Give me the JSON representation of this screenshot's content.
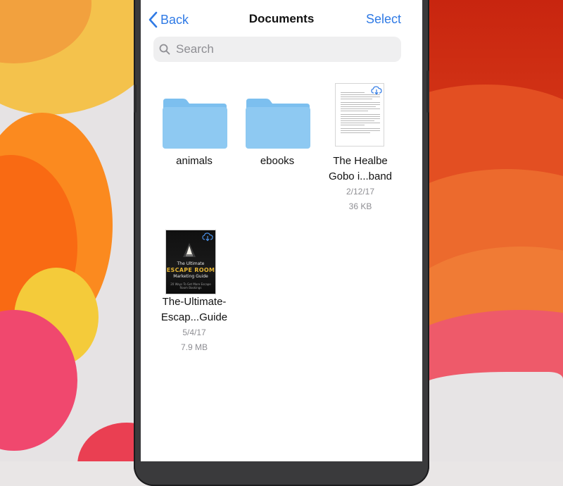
{
  "nav": {
    "back_label": "Back",
    "title": "Documents",
    "select_label": "Select"
  },
  "search": {
    "placeholder": "Search",
    "value": ""
  },
  "items": [
    {
      "type": "folder",
      "name": "animals"
    },
    {
      "type": "folder",
      "name": "ebooks"
    },
    {
      "type": "document",
      "name_line1": "The Healbe",
      "name_line2": "Gobo i...band",
      "date": "2/12/17",
      "size": "36 KB",
      "cloud": true
    },
    {
      "type": "ebook",
      "name_line1": "The-Ultimate-",
      "name_line2": "Escap...Guide",
      "date": "5/4/17",
      "size": "7.9 MB",
      "cloud": true,
      "cover": {
        "line1": "The Ultimate",
        "line2": "ESCAPE ROOM",
        "line3": "Marketing Guide",
        "line4": "20 Ways To Get More Escape Room Bookings"
      }
    }
  ],
  "colors": {
    "accent": "#2f7ae5",
    "folder": "#8ec9f2",
    "folder_tab": "#7cbfef",
    "secondary_text": "#8e8e93"
  },
  "icons": {
    "back": "chevron-left-icon",
    "search": "search-icon",
    "folder": "folder-icon",
    "cloud_download": "cloud-download-icon"
  }
}
